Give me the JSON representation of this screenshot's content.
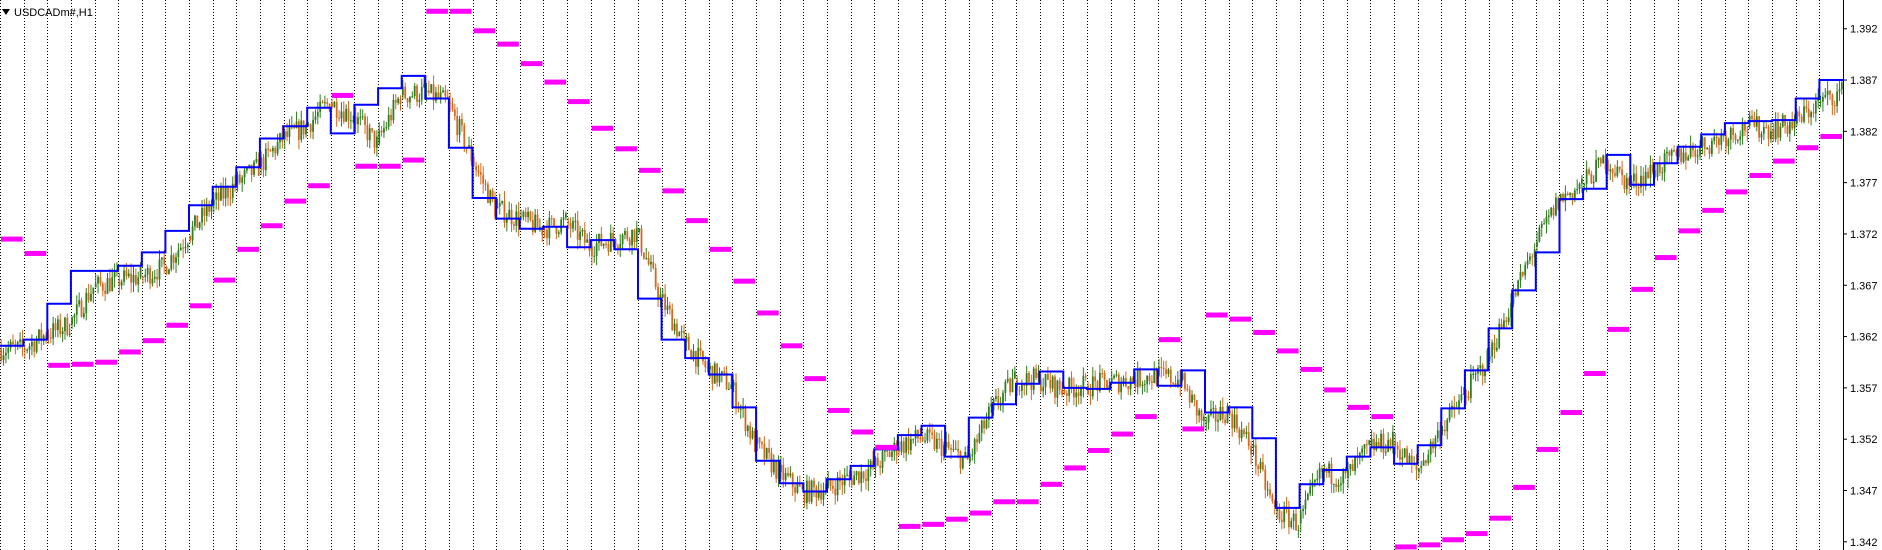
{
  "window": {
    "symbol_label": "USDCADm#,H1",
    "menu_icon": "triangle-down-icon"
  },
  "colors": {
    "background": "#ffffff",
    "grid": "#000000",
    "candle_up": "#2e7d1e",
    "candle_down": "#d2691e",
    "step_line": "#0000ff",
    "magenta_levels": "#ff00ff"
  },
  "chart_data": {
    "type": "line",
    "title": "USDCADm#,H1",
    "grid": true,
    "y_axis_side": "right",
    "ylim": [
      1.3412,
      1.3948
    ],
    "y_ticks": [
      "1.392",
      "1.387",
      "1.382",
      "1.377",
      "1.372",
      "1.367",
      "1.362",
      "1.357",
      "1.352",
      "1.347",
      "1.342"
    ],
    "y_tick_values": [
      1.392,
      1.387,
      1.382,
      1.377,
      1.372,
      1.367,
      1.362,
      1.357,
      1.352,
      1.347,
      1.342
    ],
    "x_range": [
      0,
      78
    ],
    "series": [
      {
        "style": "candlestick",
        "values": [
          [
            0,
            1.3608
          ],
          [
            1,
            1.3622
          ],
          [
            2,
            1.3632
          ],
          [
            3,
            1.3668
          ],
          [
            4,
            1.3675
          ],
          [
            5,
            1.3678
          ],
          [
            6,
            1.3688
          ],
          [
            7,
            1.3718
          ],
          [
            8,
            1.3748
          ],
          [
            9,
            1.3768
          ],
          [
            10,
            1.3785
          ],
          [
            11,
            1.3812
          ],
          [
            12,
            1.3825
          ],
          [
            13,
            1.3848
          ],
          [
            14,
            1.3835
          ],
          [
            15,
            1.3808
          ],
          [
            16,
            1.3855
          ],
          [
            17,
            1.3858
          ],
          [
            18,
            1.3848
          ],
          [
            19,
            1.3795
          ],
          [
            20,
            1.3745
          ],
          [
            21,
            1.3735
          ],
          [
            22,
            1.3725
          ],
          [
            23,
            1.3732
          ],
          [
            24,
            1.3708
          ],
          [
            25,
            1.3715
          ],
          [
            26,
            1.3722
          ],
          [
            27,
            1.3658
          ],
          [
            28,
            1.3615
          ],
          [
            29,
            1.3588
          ],
          [
            30,
            1.3572
          ],
          [
            31,
            1.3515
          ],
          [
            32,
            1.3488
          ],
          [
            33,
            1.3468
          ],
          [
            34,
            1.3472
          ],
          [
            35,
            1.3482
          ],
          [
            36,
            1.3492
          ],
          [
            37,
            1.3512
          ],
          [
            38,
            1.3522
          ],
          [
            39,
            1.3512
          ],
          [
            40,
            1.3498
          ],
          [
            41,
            1.3548
          ],
          [
            42,
            1.3578
          ],
          [
            43,
            1.3578
          ],
          [
            44,
            1.3568
          ],
          [
            45,
            1.3572
          ],
          [
            46,
            1.3575
          ],
          [
            47,
            1.3578
          ],
          [
            48,
            1.3582
          ],
          [
            49,
            1.3578
          ],
          [
            50,
            1.3535
          ],
          [
            51,
            1.3548
          ],
          [
            52,
            1.3512
          ],
          [
            53,
            1.345
          ],
          [
            54,
            1.3438
          ],
          [
            55,
            1.3488
          ],
          [
            56,
            1.3482
          ],
          [
            57,
            1.3512
          ],
          [
            58,
            1.3518
          ],
          [
            59,
            1.3488
          ],
          [
            60,
            1.3528
          ],
          [
            61,
            1.3562
          ],
          [
            62,
            1.3598
          ],
          [
            63,
            1.3652
          ],
          [
            64,
            1.3708
          ],
          [
            65,
            1.3752
          ],
          [
            66,
            1.3768
          ],
          [
            67,
            1.3792
          ],
          [
            68,
            1.3768
          ],
          [
            69,
            1.3782
          ],
          [
            70,
            1.3795
          ],
          [
            71,
            1.3805
          ],
          [
            72,
            1.3815
          ],
          [
            73,
            1.3825
          ],
          [
            74,
            1.3822
          ],
          [
            75,
            1.3828
          ],
          [
            76,
            1.3848
          ],
          [
            77,
            1.3858
          ]
        ]
      },
      {
        "style": "step",
        "color": "#0000ff",
        "values": [
          [
            0,
            1.3611
          ],
          [
            1,
            1.3617
          ],
          [
            2,
            1.3652
          ],
          [
            3,
            1.3684
          ],
          [
            4,
            1.3684
          ],
          [
            5,
            1.3689
          ],
          [
            6,
            1.3702
          ],
          [
            7,
            1.3723
          ],
          [
            8,
            1.3748
          ],
          [
            9,
            1.3766
          ],
          [
            10,
            1.3785
          ],
          [
            11,
            1.3813
          ],
          [
            12,
            1.3825
          ],
          [
            13,
            1.3843
          ],
          [
            14,
            1.3818
          ],
          [
            15,
            1.3846
          ],
          [
            16,
            1.3862
          ],
          [
            17,
            1.3874
          ],
          [
            18,
            1.3852
          ],
          [
            19,
            1.3804
          ],
          [
            20,
            1.3755
          ],
          [
            21,
            1.3735
          ],
          [
            22,
            1.3725
          ],
          [
            23,
            1.3727
          ],
          [
            24,
            1.3707
          ],
          [
            25,
            1.3714
          ],
          [
            26,
            1.3705
          ],
          [
            27,
            1.3657
          ],
          [
            28,
            1.3617
          ],
          [
            29,
            1.3599
          ],
          [
            30,
            1.3583
          ],
          [
            31,
            1.3551
          ],
          [
            32,
            1.3499
          ],
          [
            33,
            1.3477
          ],
          [
            34,
            1.3469
          ],
          [
            35,
            1.3481
          ],
          [
            36,
            1.3494
          ],
          [
            37,
            1.351
          ],
          [
            38,
            1.3524
          ],
          [
            39,
            1.3533
          ],
          [
            40,
            1.3503
          ],
          [
            41,
            1.3541
          ],
          [
            42,
            1.3554
          ],
          [
            43,
            1.3574
          ],
          [
            44,
            1.3586
          ],
          [
            45,
            1.357
          ],
          [
            46,
            1.3569
          ],
          [
            47,
            1.3575
          ],
          [
            48,
            1.3588
          ],
          [
            49,
            1.3572
          ],
          [
            50,
            1.3587
          ],
          [
            51,
            1.3546
          ],
          [
            52,
            1.3551
          ],
          [
            53,
            1.3521
          ],
          [
            54,
            1.3453
          ],
          [
            55,
            1.3476
          ],
          [
            56,
            1.349
          ],
          [
            57,
            1.3503
          ],
          [
            58,
            1.3512
          ],
          [
            59,
            1.3496
          ],
          [
            60,
            1.3514
          ],
          [
            61,
            1.355
          ],
          [
            62,
            1.3587
          ],
          [
            63,
            1.3628
          ],
          [
            64,
            1.3665
          ],
          [
            65,
            1.3702
          ],
          [
            66,
            1.3754
          ],
          [
            67,
            1.3764
          ],
          [
            68,
            1.3797
          ],
          [
            69,
            1.3768
          ],
          [
            70,
            1.3789
          ],
          [
            71,
            1.3805
          ],
          [
            72,
            1.3817
          ],
          [
            73,
            1.3828
          ],
          [
            74,
            1.383
          ],
          [
            75,
            1.3831
          ],
          [
            76,
            1.3852
          ],
          [
            77,
            1.387
          ]
        ]
      },
      {
        "style": "dash-levels",
        "color": "#ff00ff",
        "values": [
          [
            0,
            1.3715
          ],
          [
            1,
            1.3701
          ],
          [
            2,
            1.3592
          ],
          [
            3,
            1.3593
          ],
          [
            4,
            1.3595
          ],
          [
            5,
            1.3605
          ],
          [
            6,
            1.3616
          ],
          [
            7,
            1.3631
          ],
          [
            8,
            1.365
          ],
          [
            9,
            1.3675
          ],
          [
            10,
            1.3705
          ],
          [
            11,
            1.3728
          ],
          [
            12,
            1.3752
          ],
          [
            13,
            1.3767
          ],
          [
            14,
            1.3855
          ],
          [
            15,
            1.3786
          ],
          [
            16,
            1.3786
          ],
          [
            17,
            1.3792
          ],
          [
            18,
            1.3937
          ],
          [
            19,
            1.3937
          ],
          [
            20,
            1.3918
          ],
          [
            21,
            1.3905
          ],
          [
            22,
            1.3886
          ],
          [
            23,
            1.3868
          ],
          [
            24,
            1.3849
          ],
          [
            25,
            1.3823
          ],
          [
            26,
            1.3803
          ],
          [
            27,
            1.3782
          ],
          [
            28,
            1.3762
          ],
          [
            29,
            1.3733
          ],
          [
            30,
            1.3705
          ],
          [
            31,
            1.3674
          ],
          [
            32,
            1.3643
          ],
          [
            33,
            1.3611
          ],
          [
            34,
            1.3579
          ],
          [
            35,
            1.3548
          ],
          [
            36,
            1.3527
          ],
          [
            37,
            1.3512
          ],
          [
            38,
            1.3435
          ],
          [
            39,
            1.3437
          ],
          [
            40,
            1.3442
          ],
          [
            41,
            1.3448
          ],
          [
            42,
            1.3459
          ],
          [
            43,
            1.3459
          ],
          [
            44,
            1.3476
          ],
          [
            45,
            1.3492
          ],
          [
            46,
            1.3509
          ],
          [
            47,
            1.3525
          ],
          [
            48,
            1.3542
          ],
          [
            49,
            1.3617
          ],
          [
            50,
            1.353
          ],
          [
            51,
            1.3641
          ],
          [
            52,
            1.3637
          ],
          [
            53,
            1.3624
          ],
          [
            54,
            1.3606
          ],
          [
            55,
            1.3588
          ],
          [
            56,
            1.3568
          ],
          [
            57,
            1.3551
          ],
          [
            58,
            1.3542
          ],
          [
            59,
            1.3415
          ],
          [
            60,
            1.3417
          ],
          [
            61,
            1.3422
          ],
          [
            62,
            1.3428
          ],
          [
            63,
            1.3443
          ],
          [
            64,
            1.3473
          ],
          [
            65,
            1.351
          ],
          [
            66,
            1.3546
          ],
          [
            67,
            1.3584
          ],
          [
            68,
            1.3627
          ],
          [
            69,
            1.3666
          ],
          [
            70,
            1.3697
          ],
          [
            71,
            1.3723
          ],
          [
            72,
            1.3743
          ],
          [
            73,
            1.3761
          ],
          [
            74,
            1.3777
          ],
          [
            75,
            1.3791
          ],
          [
            76,
            1.3804
          ],
          [
            77,
            1.3815
          ]
        ]
      }
    ]
  }
}
